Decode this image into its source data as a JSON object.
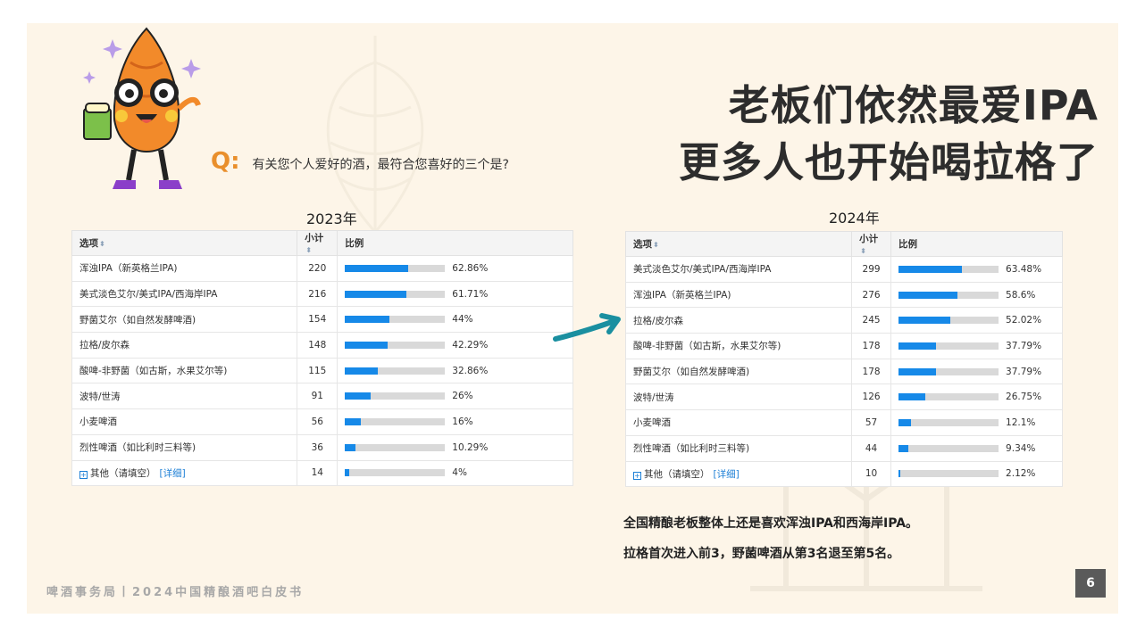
{
  "question": {
    "q_label": "Q:",
    "text": "有关您个人爱好的酒，最符合您喜好的三个是?"
  },
  "headline": {
    "line1": "老板们依然最爱IPA",
    "line2": "更多人也开始喝拉格了"
  },
  "tables": [
    {
      "year": "2023年",
      "headers": {
        "option": "选项",
        "count": "小计",
        "ratio": "比例"
      },
      "rows": [
        {
          "option": "浑浊IPA（新英格兰IPA)",
          "count": "220",
          "pct_label": "62.86%",
          "pct": 62.86
        },
        {
          "option": "美式淡色艾尔/美式IPA/西海岸IPA",
          "count": "216",
          "pct_label": "61.71%",
          "pct": 61.71
        },
        {
          "option": "野菌艾尔（如自然发酵啤酒)",
          "count": "154",
          "pct_label": "44%",
          "pct": 44
        },
        {
          "option": "拉格/皮尔森",
          "count": "148",
          "pct_label": "42.29%",
          "pct": 42.29
        },
        {
          "option": "酸啤-非野菌（如古斯，水果艾尔等)",
          "count": "115",
          "pct_label": "32.86%",
          "pct": 32.86
        },
        {
          "option": "波特/世涛",
          "count": "91",
          "pct_label": "26%",
          "pct": 26
        },
        {
          "option": "小麦啤酒",
          "count": "56",
          "pct_label": "16%",
          "pct": 16
        },
        {
          "option": "烈性啤酒（如比利时三料等)",
          "count": "36",
          "pct_label": "10.29%",
          "pct": 10.29
        }
      ],
      "other": {
        "label": "其他（请填空）",
        "link": "[详细]",
        "count": "14",
        "pct_label": "4%",
        "pct": 4
      }
    },
    {
      "year": "2024年",
      "headers": {
        "option": "选项",
        "count": "小计",
        "ratio": "比例"
      },
      "rows": [
        {
          "option": "美式淡色艾尔/美式IPA/西海岸IPA",
          "count": "299",
          "pct_label": "63.48%",
          "pct": 63.48
        },
        {
          "option": "浑浊IPA（新英格兰IPA)",
          "count": "276",
          "pct_label": "58.6%",
          "pct": 58.6
        },
        {
          "option": "拉格/皮尔森",
          "count": "245",
          "pct_label": "52.02%",
          "pct": 52.02
        },
        {
          "option": "酸啤-非野菌（如古斯，水果艾尔等)",
          "count": "178",
          "pct_label": "37.79%",
          "pct": 37.79
        },
        {
          "option": "野菌艾尔（如自然发酵啤酒)",
          "count": "178",
          "pct_label": "37.79%",
          "pct": 37.79
        },
        {
          "option": "波特/世涛",
          "count": "126",
          "pct_label": "26.75%",
          "pct": 26.75
        },
        {
          "option": "小麦啤酒",
          "count": "57",
          "pct_label": "12.1%",
          "pct": 12.1
        },
        {
          "option": "烈性啤酒（如比利时三料等)",
          "count": "44",
          "pct_label": "9.34%",
          "pct": 9.34
        }
      ],
      "other": {
        "label": "其他（请填空）",
        "link": "[详细]",
        "count": "10",
        "pct_label": "2.12%",
        "pct": 2.12
      }
    }
  ],
  "summary": {
    "line1": "全国精酿老板整体上还是喜欢浑浊IPA和西海岸IPA。",
    "line2": "拉格首次进入前3，野菌啤酒从第3名退至第5名。"
  },
  "footer": "啤酒事务局丨2024中国精酿酒吧白皮书",
  "page_number": "6",
  "colors": {
    "bar": "#1689e8",
    "track": "#d9d9d9",
    "q_mark": "#e98f2c",
    "arrow": "#1a8fa0"
  }
}
